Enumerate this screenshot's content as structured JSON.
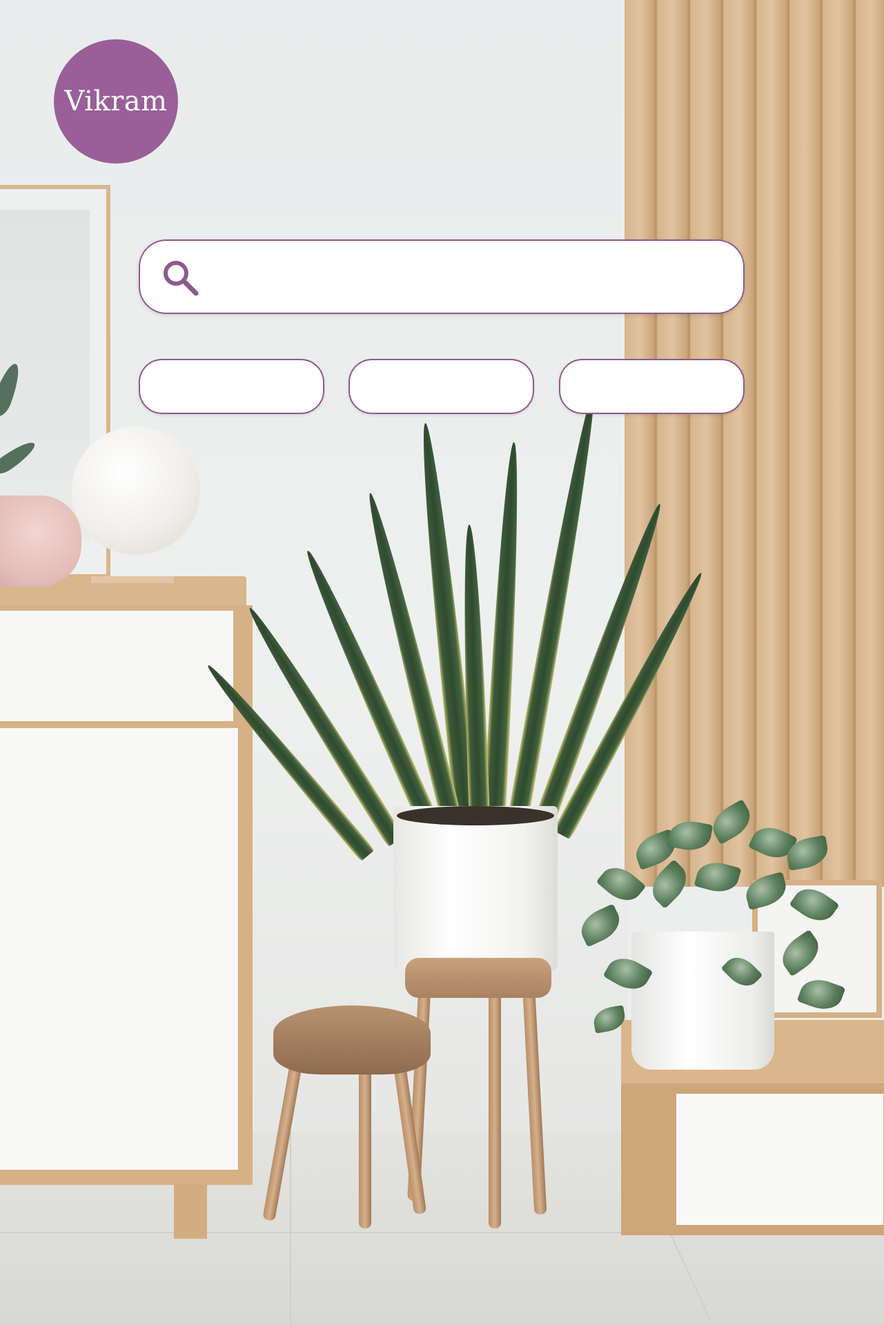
{
  "profile": {
    "name": "Vikram",
    "avatar_color": "#9a5f99"
  },
  "search": {
    "placeholder": "",
    "value": "",
    "icon": "search-icon",
    "accent_color": "#8d5a8d"
  },
  "chips": [
    {
      "label": ""
    },
    {
      "label": ""
    },
    {
      "label": ""
    }
  ]
}
